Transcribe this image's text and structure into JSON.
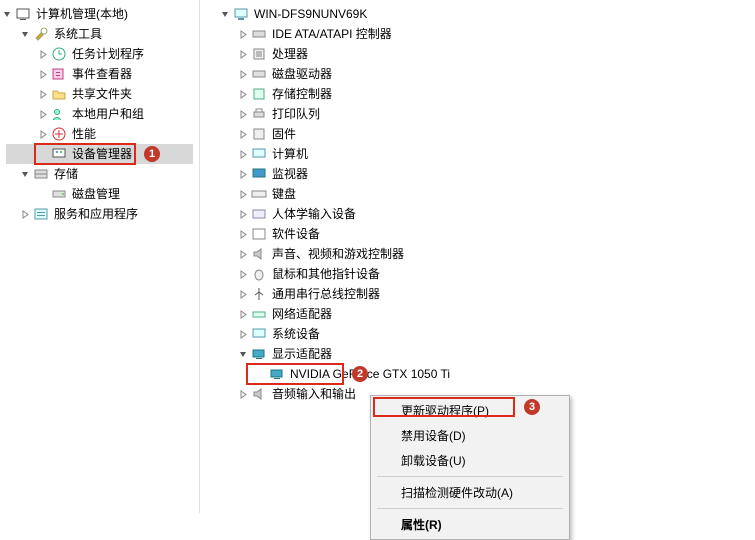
{
  "left": {
    "root": "计算机管理(本地)",
    "sys_tools": "系统工具",
    "task_scheduler": "任务计划程序",
    "event_viewer": "事件查看器",
    "shared_folders": "共享文件夹",
    "local_users": "本地用户和组",
    "performance": "性能",
    "device_manager": "设备管理器",
    "storage": "存储",
    "disk_mgmt": "磁盘管理",
    "services_apps": "服务和应用程序"
  },
  "right": {
    "computer": "WIN-DFS9NUNV69K",
    "ide": "IDE ATA/ATAPI 控制器",
    "cpu": "处理器",
    "disk_drives": "磁盘驱动器",
    "storage_ctl": "存储控制器",
    "print_queue": "打印队列",
    "firmware": "固件",
    "computers": "计算机",
    "monitors": "监视器",
    "keyboards": "键盘",
    "hid": "人体学输入设备",
    "software_dev": "软件设备",
    "sound": "声音、视频和游戏控制器",
    "mice": "鼠标和其他指针设备",
    "usb": "通用串行总线控制器",
    "network": "网络适配器",
    "system_dev": "系统设备",
    "display": "显示适配器",
    "gpu": "NVIDIA GeForce GTX 1050 Ti",
    "audio_io": "音频输入和输出"
  },
  "menu": {
    "update": "更新驱动程序(P)",
    "disable": "禁用设备(D)",
    "uninstall": "卸载设备(U)",
    "scan": "扫描检测硬件改动(A)",
    "properties": "属性(R)"
  },
  "badges": {
    "one": "1",
    "two": "2",
    "three": "3"
  }
}
